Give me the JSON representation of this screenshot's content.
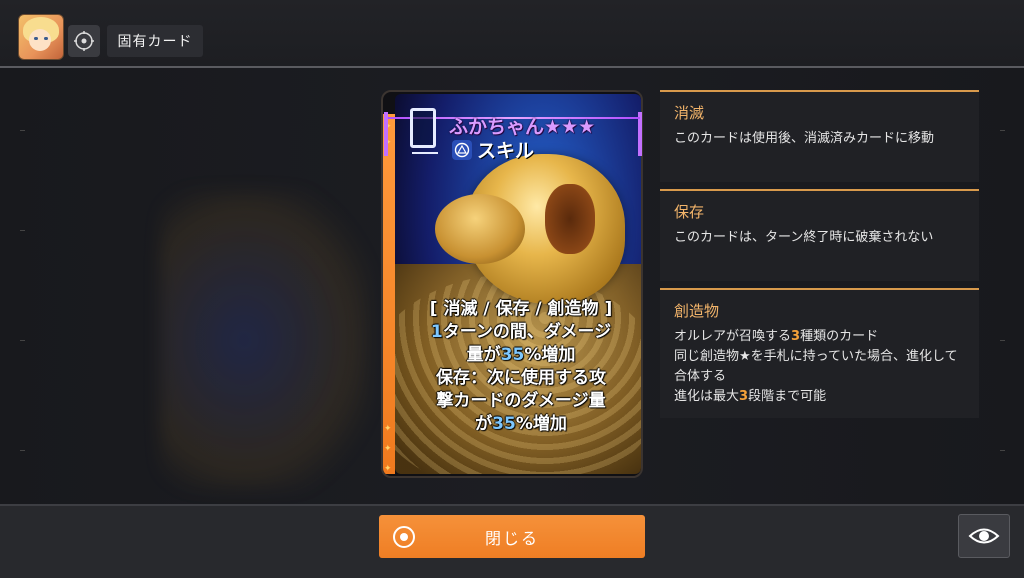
{
  "header": {
    "title": "固有カード"
  },
  "card": {
    "cost": "0",
    "name": "ふかちゃん★★★",
    "type": "スキル",
    "tags": "[ 消滅 / 保存 / 創造物 ]",
    "desc_line1_num": "1",
    "desc_line1_rest": "ターンの間、ダメージ",
    "desc_line2_a": "量が",
    "desc_line2_num": "35",
    "desc_line2_b": "%増加",
    "desc_line3": "保存：次に使用する攻",
    "desc_line4": "撃カードのダメージ量",
    "desc_line5_a": "が",
    "desc_line5_num": "35",
    "desc_line5_b": "%増加"
  },
  "keywords": [
    {
      "title": "消滅",
      "text": "このカードは使用後、消滅済みカードに移動"
    },
    {
      "title": "保存",
      "text": "このカードは、ターン終了時に破棄されない"
    },
    {
      "title": "創造物",
      "line1_a": "オルレアが召喚する",
      "line1_num": "3",
      "line1_b": "種類のカード",
      "line2": "同じ創造物★を手札に持っていた場合、進化して合体する",
      "line3_a": "進化は最大",
      "line3_num": "3",
      "line3_b": "段階まで可能"
    }
  ],
  "footer": {
    "close_label": "閉じる"
  },
  "icons": {
    "target": "target-icon",
    "skill": "skill-icon",
    "close": "circle-icon",
    "view": "eye-icon"
  },
  "colors": {
    "accent": "#ef7e24",
    "keyword_title": "#f2b46a",
    "highlight": "#f5a23a",
    "card_name": "#d99bff",
    "number_blue": "#7ec8ff"
  }
}
